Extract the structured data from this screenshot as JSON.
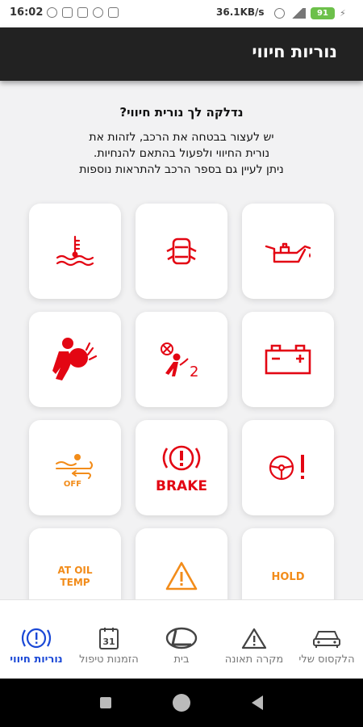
{
  "status_bar": {
    "time": "16:02",
    "speed": "36.1KB/s",
    "battery": "91"
  },
  "header": {
    "title": "נוריות חיווי"
  },
  "intro": {
    "heading": "נדלקה לך נורית חיווי?",
    "body_line1": "יש לעצור בבטחה את הרכב, לזהות את",
    "body_line2": "נורית החיווי ולפעול בהתאם להנחיות.",
    "body_line3": "ניתן לעיין גם בספר הרכב להתראות נוספות"
  },
  "colors": {
    "red": "#e30613",
    "orange": "#f28c1a",
    "nav_active": "#1a48d6",
    "nav_inactive": "#777777"
  },
  "lights": {
    "brake_label": "BRAKE",
    "off_label": "OFF",
    "at_oil_label_1": "AT OIL",
    "at_oil_label_2": "TEMP",
    "hold_label": "HOLD",
    "airbag_num": "2",
    "icons": [
      "oil-pressure-icon",
      "door-open-icon",
      "coolant-temperature-icon",
      "battery-icon",
      "passenger-airbag-off-icon",
      "airbag-icon",
      "power-steering-icon",
      "brake-warning-icon",
      "sunroof-off-icon",
      "auto-hold-icon",
      "master-warning-icon",
      "at-oil-temp-icon"
    ]
  },
  "bottom_nav": {
    "items": [
      {
        "label": "הלקסוס שלי",
        "icon": "car-icon"
      },
      {
        "label": "מקרה תאונה",
        "icon": "warning-triangle-icon"
      },
      {
        "label": "בית",
        "icon": "lexus-logo-icon"
      },
      {
        "label": "הזמנות טיפול",
        "icon": "calendar-icon",
        "day": "31"
      },
      {
        "label": "נוריות חיווי",
        "icon": "warning-light-icon"
      }
    ]
  }
}
